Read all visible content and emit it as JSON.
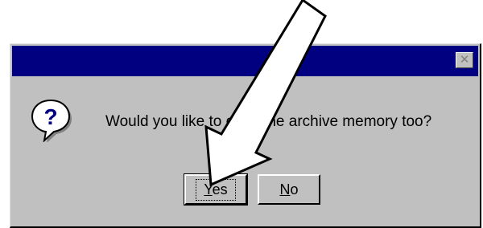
{
  "window": {
    "close_glyph": "✕"
  },
  "dialog": {
    "message": "Would you like to clear the archive memory too?",
    "icon": "question-icon"
  },
  "buttons": {
    "yes": {
      "label": "Yes",
      "mnemonic": "Y",
      "rest": "es"
    },
    "no": {
      "label": "No",
      "mnemonic": "N",
      "rest": "o"
    }
  },
  "annotation": {
    "icon": "pointer-arrow-icon",
    "color": "#ffffff",
    "outline": "#000000"
  },
  "colors": {
    "titlebar": "#000080",
    "dialog_face": "#c0c0c0",
    "icon_bubble": "#ffffff",
    "icon_question": "#000080"
  }
}
